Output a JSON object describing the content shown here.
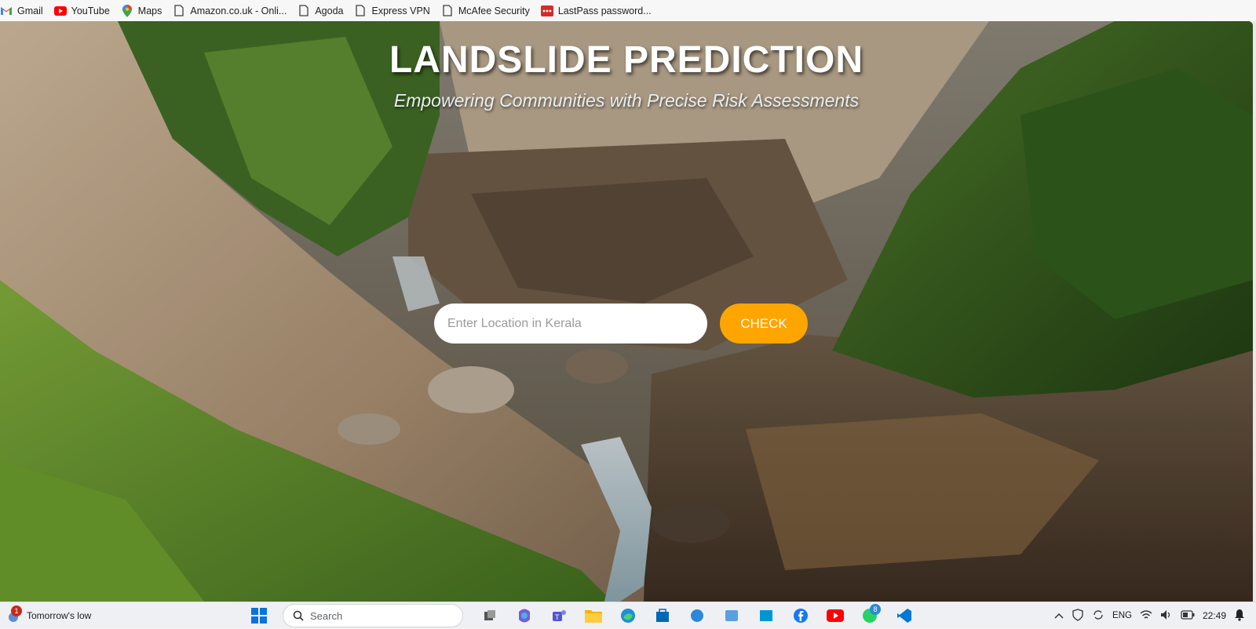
{
  "bookmarks": [
    {
      "label": "Gmail",
      "icon": "gmail-icon"
    },
    {
      "label": "YouTube",
      "icon": "youtube-icon"
    },
    {
      "label": "Maps",
      "icon": "maps-pin-icon"
    },
    {
      "label": "Amazon.co.uk - Onli...",
      "icon": "page-icon"
    },
    {
      "label": "Agoda",
      "icon": "page-icon"
    },
    {
      "label": "Express VPN",
      "icon": "page-icon"
    },
    {
      "label": "McAfee Security",
      "icon": "page-icon"
    },
    {
      "label": "LastPass password...",
      "icon": "lastpass-icon"
    }
  ],
  "hero": {
    "title": "LANDSLIDE PREDICTION",
    "subtitle": "Empowering Communities with Precise Risk Assessments",
    "input_placeholder": "Enter Location in Kerala",
    "check_label": "CHECK"
  },
  "colors": {
    "check_button": "#ffa500",
    "title_text": "#ffffff"
  },
  "taskbar": {
    "weather_text": "Tomorrow's low",
    "weather_badge": "1",
    "search_placeholder": "Search",
    "whatsapp_badge": "8",
    "language": "ENG",
    "time": "22:49"
  }
}
